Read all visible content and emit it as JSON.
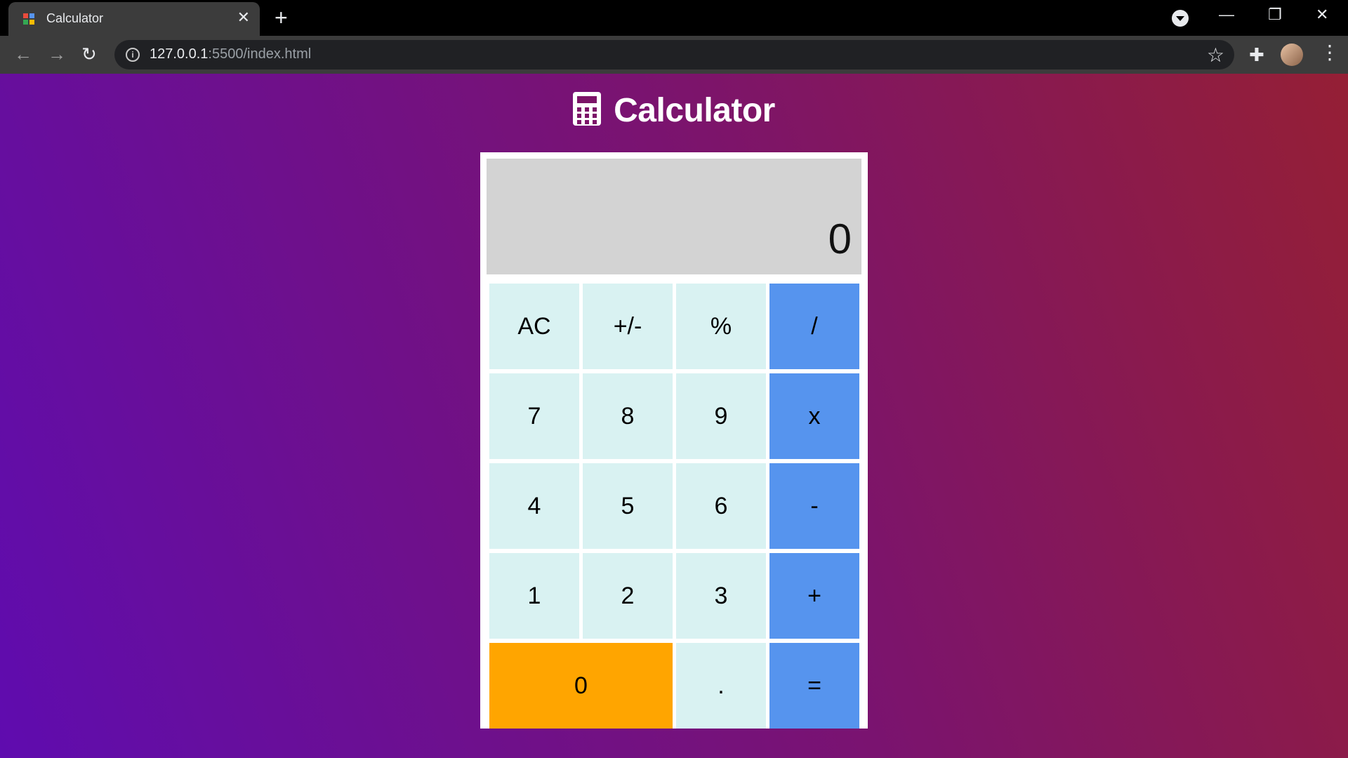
{
  "browser": {
    "tab_title": "Calculator",
    "url_host": "127.0.0.1",
    "url_path": ":5500/index.html"
  },
  "page": {
    "heading": "Calculator",
    "colors": {
      "gradient_start": "#5f0caf",
      "gradient_end": "#951f35",
      "number_key": "#d9f2f2",
      "operator_key": "#5694ee",
      "zero_key": "#ffa500",
      "display": "#d3d3d3"
    }
  },
  "calculator": {
    "display_value": "0",
    "keys": {
      "ac": "AC",
      "sign": "+/-",
      "percent": "%",
      "divide": "/",
      "seven": "7",
      "eight": "8",
      "nine": "9",
      "multiply": "x",
      "four": "4",
      "five": "5",
      "six": "6",
      "subtract": "-",
      "one": "1",
      "two": "2",
      "three": "3",
      "add": "+",
      "zero": "0",
      "decimal": ".",
      "equals": "="
    }
  }
}
